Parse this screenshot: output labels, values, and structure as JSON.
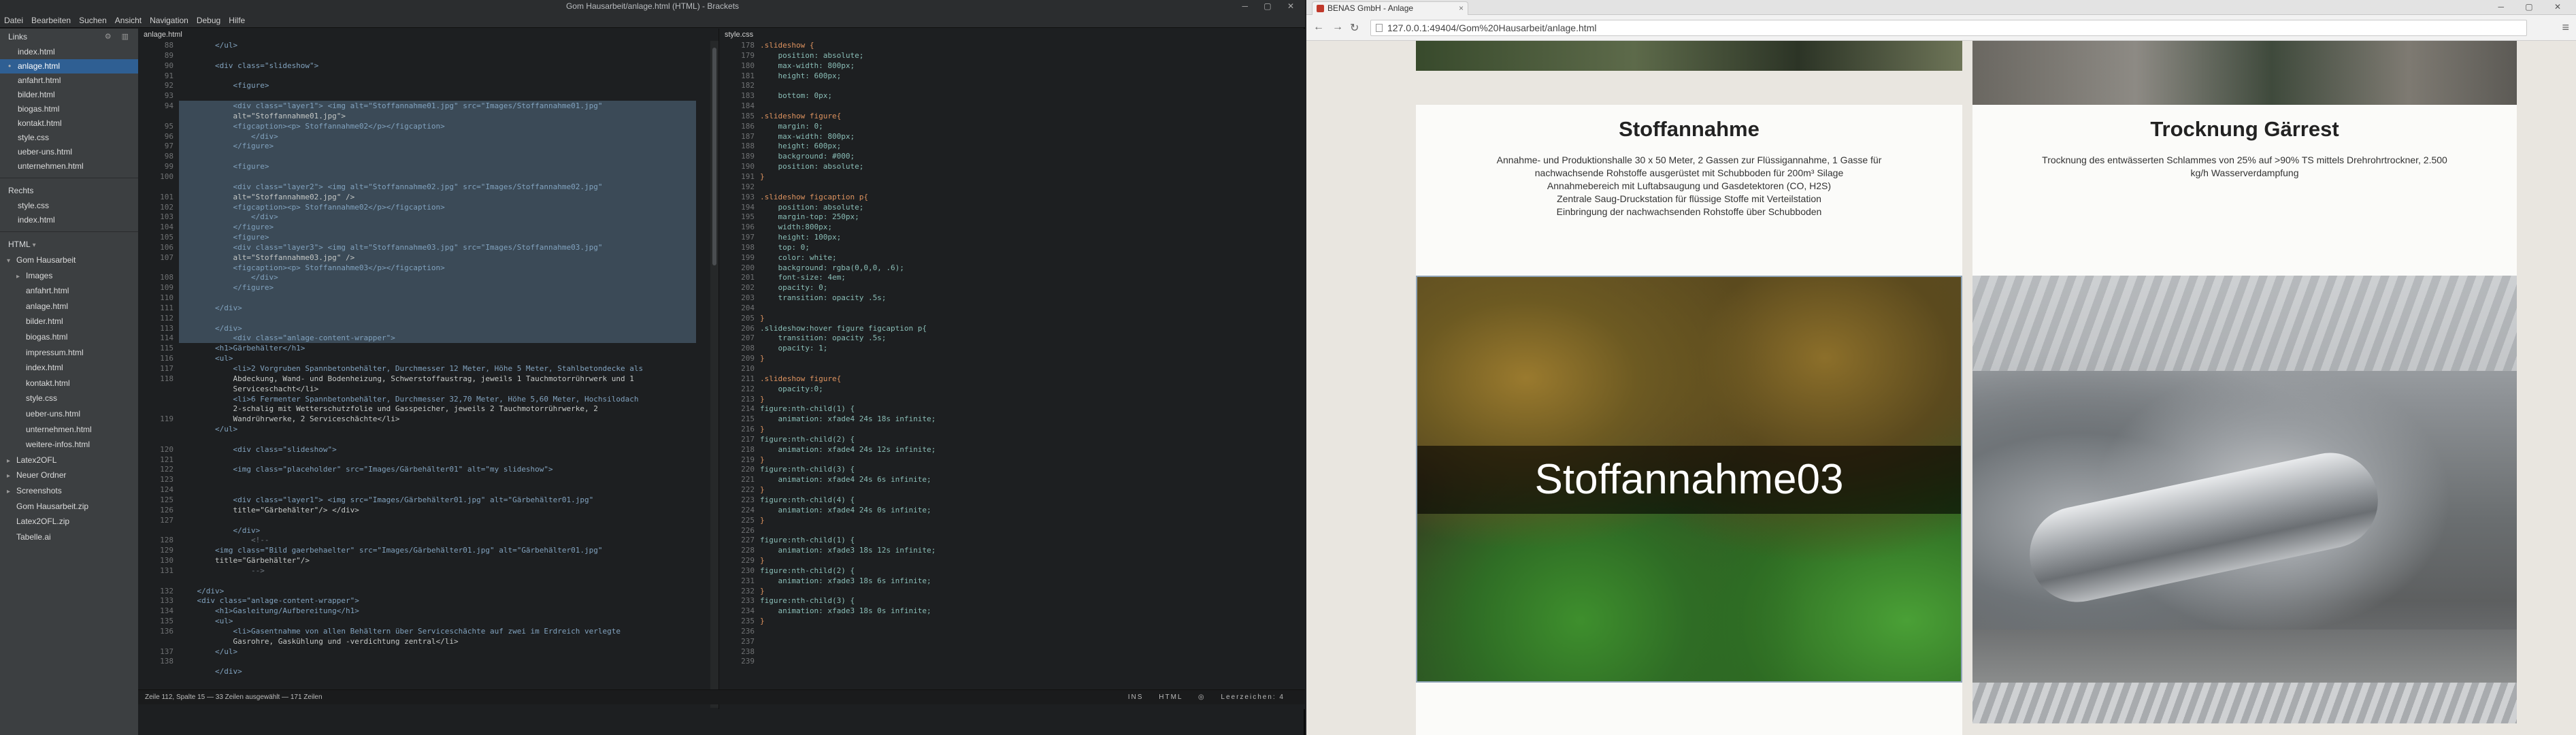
{
  "editor": {
    "window_title": "Gom Hausarbeit/anlage.html (HTML) - Brackets",
    "menu": [
      "Datei",
      "Bearbeiten",
      "Suchen",
      "Ansicht",
      "Navigation",
      "Debug",
      "Hilfe"
    ],
    "sidebar": {
      "links_title": "Links",
      "links_files": [
        "index.html",
        "anlage.html",
        "anfahrt.html",
        "bilder.html",
        "biogas.html",
        "kontakt.html",
        "style.css",
        "ueber-uns.html",
        "unternehmen.html"
      ],
      "rechts_title": "Rechts",
      "rechts_files": [
        "style.css",
        "index.html"
      ],
      "project_label": "HTML",
      "tree": [
        {
          "label": "Gom Hausarbeit",
          "level": 0,
          "arrow": "▾"
        },
        {
          "label": "Images",
          "level": 1,
          "arrow": "▸"
        },
        {
          "label": "anfahrt.html",
          "level": 1,
          "arrow": ""
        },
        {
          "label": "anlage.html",
          "level": 1,
          "arrow": ""
        },
        {
          "label": "bilder.html",
          "level": 1,
          "arrow": ""
        },
        {
          "label": "biogas.html",
          "level": 1,
          "arrow": ""
        },
        {
          "label": "impressum.html",
          "level": 1,
          "arrow": ""
        },
        {
          "label": "index.html",
          "level": 1,
          "arrow": ""
        },
        {
          "label": "kontakt.html",
          "level": 1,
          "arrow": ""
        },
        {
          "label": "style.css",
          "level": 1,
          "arrow": ""
        },
        {
          "label": "ueber-uns.html",
          "level": 1,
          "arrow": ""
        },
        {
          "label": "unternehmen.html",
          "level": 1,
          "arrow": ""
        },
        {
          "label": "weitere-infos.html",
          "level": 1,
          "arrow": ""
        },
        {
          "label": "Latex2OFL",
          "level": 0,
          "arrow": "▸"
        },
        {
          "label": "Neuer Ordner",
          "level": 0,
          "arrow": "▸"
        },
        {
          "label": "Screenshots",
          "level": 0,
          "arrow": "▸"
        },
        {
          "label": "Gom Hausarbeit.zip",
          "level": 0,
          "arrow": ""
        },
        {
          "label": "Latex2OFL.zip",
          "level": 0,
          "arrow": ""
        },
        {
          "label": "Tabelle.ai",
          "level": 0,
          "arrow": ""
        }
      ]
    },
    "pane_left": {
      "tab": "anlage.html",
      "line_numbers": [
        "88",
        "89",
        "90",
        "91",
        "92",
        "93",
        "94",
        "",
        "95",
        "96",
        "97",
        "98",
        "99",
        "100",
        "",
        "101",
        "102",
        "103",
        "104",
        "105",
        "106",
        "107",
        "",
        "108",
        "109",
        "110",
        "111",
        "112",
        "113",
        "114",
        "115",
        "116",
        "117",
        "118",
        "",
        "",
        "",
        "119",
        "",
        "",
        "120",
        "121",
        "122",
        "123",
        "124",
        "125",
        "126",
        "127",
        "",
        "128",
        "129",
        "130",
        "131",
        "",
        "132",
        "133",
        "134",
        "135",
        "136",
        "",
        "137",
        "138"
      ],
      "code": [
        "        </ul>",
        "",
        "        <div class=\"slideshow\">",
        "",
        "            <figure>",
        "",
        "            <div class=\"layer1\"> <img alt=\"Stoffannahme01.jpg\" src=\"Images/Stoffannahme01.jpg\"",
        "            alt=\"Stoffannahme01.jpg\">",
        "            <figcaption><p> Stoffannahme02</p></figcaption>",
        "                </div>",
        "            </figure>",
        "",
        "            <figure>",
        "",
        "            <div class=\"layer2\"> <img alt=\"Stoffannahme02.jpg\" src=\"Images/Stoffannahme02.jpg\"",
        "            alt=\"Stoffannahme02.jpg\" />",
        "            <figcaption><p> Stoffannahme02</p></figcaption>",
        "                </div>",
        "            </figure>",
        "            <figure>",
        "            <div class=\"layer3\"> <img alt=\"Stoffannahme03.jpg\" src=\"Images/Stoffannahme03.jpg\"",
        "            alt=\"Stoffannahme03.jpg\" />",
        "            <figcaption><p> Stoffannahme03</p></figcaption>",
        "                </div>",
        "            </figure>",
        "",
        "        </div>",
        "",
        "        </div>",
        "            <div class=\"anlage-content-wrapper\">",
        "        <h1>Gärbehälter</h1>",
        "        <ul>",
        "            <li>2 Vorgruben Spannbetonbehälter, Durchmesser 12 Meter, Höhe 5 Meter, Stahlbetondecke als",
        "            Abdeckung, Wand- und Bodenheizung, Schwerstoffaustrag, jeweils 1 Tauchmotorrührwerk und 1",
        "            Serviceschacht</li>",
        "            <li>6 Fermenter Spannbetonbehälter, Durchmesser 32,70 Meter, Höhe 5,60 Meter, Hochsilodach",
        "            2-schalig mit Wetterschutzfolie und Gasspeicher, jeweils 2 Tauchmotorrührwerke, 2",
        "            Wandrührwerke, 2 Serviceschächte</li>",
        "        </ul>",
        "",
        "            <div class=\"slideshow\">",
        "",
        "            <img class=\"placeholder\" src=\"Images/Gärbehälter01\" alt=\"my slideshow\">",
        "",
        "",
        "            <div class=\"layer1\"> <img src=\"Images/Gärbehälter01.jpg\" alt=\"Gärbehälter01.jpg\"",
        "            title=\"Gärbehälter\"/> </div>",
        "",
        "            </div>",
        "                <!--",
        "        <img class=\"Bild gaerbehaelter\" src=\"Images/Gärbehälter01.jpg\" alt=\"Gärbehälter01.jpg\"",
        "        title=\"Gärbehälter\"/>",
        "                -->",
        "",
        "    </div>",
        "    <div class=\"anlage-content-wrapper\">",
        "        <h1>Gasleitung/Aufbereitung</h1>",
        "        <ul>",
        "            <li>Gasentnahme von allen Behältern über Serviceschächte auf zwei im Erdreich verlegte",
        "            Gasrohre, Gaskühlung und -verdichtung zentral</li>",
        "        </ul>",
        "",
        "        </div>"
      ]
    },
    "pane_right": {
      "tab": "style.css",
      "line_numbers": [
        "178",
        "179",
        "180",
        "181",
        "182",
        "183",
        "184",
        "185",
        "186",
        "187",
        "188",
        "189",
        "190",
        "191",
        "192",
        "193",
        "194",
        "195",
        "196",
        "197",
        "198",
        "199",
        "200",
        "201",
        "202",
        "203",
        "204",
        "205",
        "206",
        "207",
        "208",
        "209",
        "210",
        "211",
        "212",
        "213",
        "214",
        "215",
        "216",
        "217",
        "218",
        "219",
        "220",
        "221",
        "222",
        "223",
        "224",
        "225",
        "226",
        "227",
        "228",
        "229",
        "230",
        "231",
        "232",
        "233",
        "234",
        "235",
        "236",
        "237",
        "238",
        "239"
      ],
      "code": [
        ".slideshow {",
        "    position: absolute;",
        "    max-width: 800px;",
        "    height: 600px;",
        "",
        "    bottom: 0px;",
        "",
        ".slideshow figure{",
        "    margin: 0;",
        "    max-width: 800px;",
        "    height: 600px;",
        "    background: #000;",
        "    position: absolute;",
        "}",
        "",
        ".slideshow figcaption p{",
        "    position: absolute;",
        "    margin-top: 250px;",
        "    width:800px;",
        "    height: 100px;",
        "    top: 0;",
        "    color: white;",
        "    background: rgba(0,0,0, .6);",
        "    font-size: 4em;",
        "    opacity: 0;",
        "    transition: opacity .5s;",
        "",
        "}",
        ".slideshow:hover figure figcaption p{",
        "    transition: opacity .5s;",
        "    opacity: 1;",
        "}",
        "",
        ".slideshow figure{",
        "    opacity:0;",
        "}",
        "figure:nth-child(1) {",
        "    animation: xfade4 24s 18s infinite;",
        "}",
        "figure:nth-child(2) {",
        "    animation: xfade4 24s 12s infinite;",
        "}",
        "figure:nth-child(3) {",
        "    animation: xfade4 24s 6s infinite;",
        "}",
        "figure:nth-child(4) {",
        "    animation: xfade4 24s 0s infinite;",
        "}",
        "",
        "figure:nth-child(1) {",
        "    animation: xfade3 18s 12s infinite;",
        "}",
        "figure:nth-child(2) {",
        "    animation: xfade3 18s 6s infinite;",
        "}",
        "figure:nth-child(3) {",
        "    animation: xfade3 18s 0s infinite;",
        "}",
        ""
      ]
    },
    "status": {
      "left": "Zeile 112, Spalte 15 — 33 Zeilen ausgewählt — 171 Zeilen",
      "ins": "INS",
      "mode": "HTML",
      "spaces": "Leerzeichen: 4"
    }
  },
  "browser": {
    "tab_title": "BENAS GmbH - Anlage",
    "url": "127.0.0.1:49404/Gom%20Hausarbeit/anlage.html",
    "left": {
      "heading": "Stoffannahme",
      "lines": [
        "Annahme- und Produktionshalle 30 x 50 Meter, 2 Gassen zur Flüssigannahme, 1 Gasse für",
        "nachwachsende Rohstoffe ausgerüstet mit Schubboden für 200m³ Silage",
        "Annahmebereich mit Luftabsaugung und Gasdetektoren (CO, H2S)",
        "Zentrale Saug-Druckstation für flüssige Stoffe mit Verteilstation",
        "Einbringung der nachwachsenden Rohstoffe über Schubboden"
      ],
      "caption": "Stoffannahme03"
    },
    "right": {
      "heading": "Trocknung Gärrest",
      "lines": [
        "Trocknung des entwässerten Schlammes von 25% auf >90% TS mittels Drehrohrtrockner, 2.500",
        "kg/h Wasserverdampfung"
      ]
    }
  }
}
